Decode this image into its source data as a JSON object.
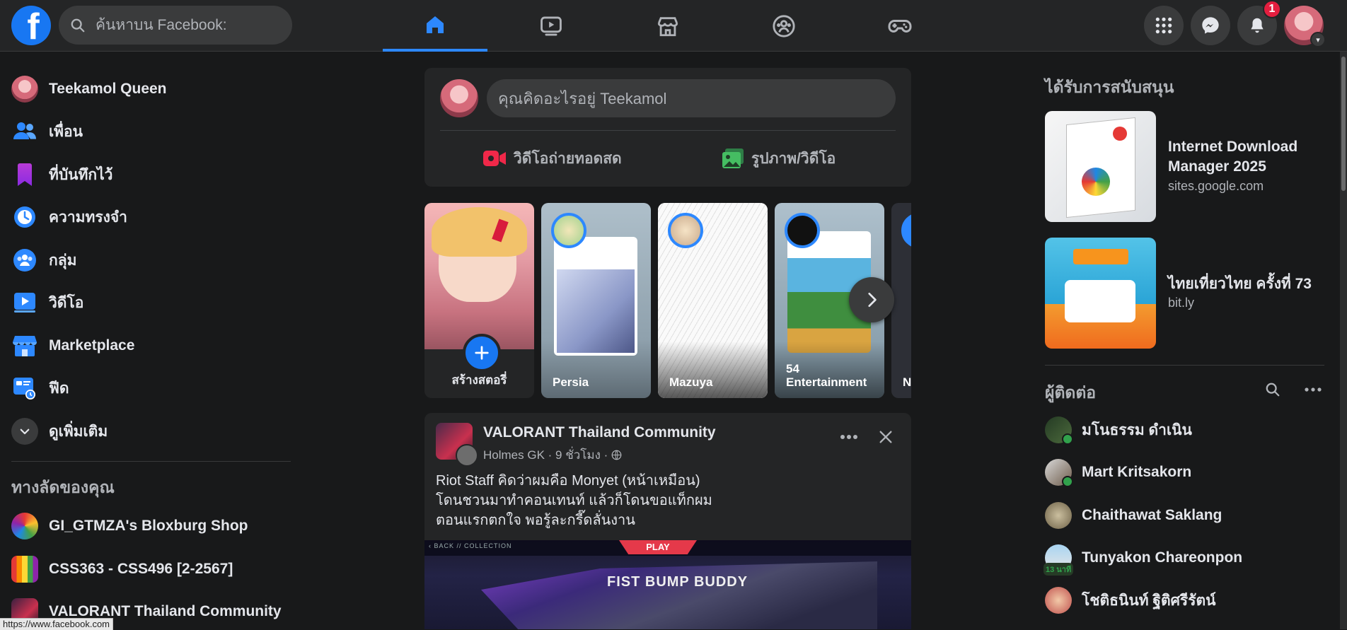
{
  "topbar": {
    "logo_letter": "f",
    "search_placeholder": "ค้นหาบน Facebook:",
    "nav_tabs": [
      "home-icon",
      "watch-icon",
      "marketplace-icon",
      "groups-icon",
      "gaming-icon"
    ],
    "active_tab": "home-icon",
    "notifications_count": "1",
    "menu_icon": "grid-menu-icon",
    "messenger_icon": "messenger-icon",
    "bell_icon": "bell-icon"
  },
  "sidebar": {
    "items": [
      {
        "label": "Teekamol Queen",
        "icon": "profile-avatar"
      },
      {
        "label": "เพื่อน",
        "icon": "friends-icon"
      },
      {
        "label": "ที่บันทึกไว้",
        "icon": "bookmark-icon"
      },
      {
        "label": "ความทรงจำ",
        "icon": "memories-clock-icon"
      },
      {
        "label": "กลุ่ม",
        "icon": "groups-icon"
      },
      {
        "label": "วิดีโอ",
        "icon": "video-icon"
      },
      {
        "label": "Marketplace",
        "icon": "marketplace-icon"
      },
      {
        "label": "ฟีด",
        "icon": "feeds-icon"
      },
      {
        "label": "ดูเพิ่มเติม",
        "icon": "chevron-down-icon"
      }
    ],
    "shortcuts_heading": "ทางลัดของคุณ",
    "shortcuts": [
      {
        "label": "GI_GTMZA's Bloxburg Shop"
      },
      {
        "label": "CSS363 - CSS496 [2-2567]"
      },
      {
        "label": "VALORANT Thailand Community"
      }
    ]
  },
  "status_url": "https://www.facebook.com",
  "composer": {
    "placeholder": "คุณคิดอะไรอยู่ Teekamol",
    "live_video_label": "วิดีโอถ่ายทอดสด",
    "photo_video_label": "รูปภาพ/วิดีโอ",
    "live_color": "#f02849",
    "photo_color": "#45bd62"
  },
  "stories": [
    {
      "name": "สร้างสตอรี่",
      "type": "create"
    },
    {
      "name": "Persia"
    },
    {
      "name": "Mazuya"
    },
    {
      "name": "54\nEntertainment"
    },
    {
      "name": "N"
    }
  ],
  "post": {
    "page_name": "VALORANT Thailand Community",
    "meta": "Holmes GK · 9 ชั่วโมง · ",
    "text_line1": "Riot Staff คิดว่าผมคือ Monyet (หน้าเหมือน)",
    "text_line2": "โดนชวนมาทำคอนเทนท์ แล้วก็โดนขอแท็กผม",
    "text_line3": "ตอนแรกตกใจ พอรู้ละกรี๊ดลั่นงาน",
    "image_tab_play": "PLAY",
    "image_caption": "FIST BUMP BUDDY",
    "image_breadcrumb": "‹ BACK // COLLECTION"
  },
  "right": {
    "sponsored_heading": "ได้รับการสนับสนุน",
    "ads": [
      {
        "title": "Internet Download Manager 2025",
        "url": "sites.google.com"
      },
      {
        "title": "ไทยเที่ยวไทย ครั้งที่ 73",
        "url": "bit.ly"
      }
    ],
    "contacts_heading": "ผู้ติดต่อ",
    "contacts": [
      {
        "name": "มโนธรรม ดำเนิน",
        "online": true
      },
      {
        "name": "Mart Kritsakorn",
        "online": true
      },
      {
        "name": "Chaithawat Saklang",
        "online": false
      },
      {
        "name": "Tunyakon Chareonpon",
        "online": false,
        "badge": "13 นาที"
      },
      {
        "name": "โชติธนินท์ ฐิติศรีรัตน์",
        "online": false
      }
    ]
  }
}
